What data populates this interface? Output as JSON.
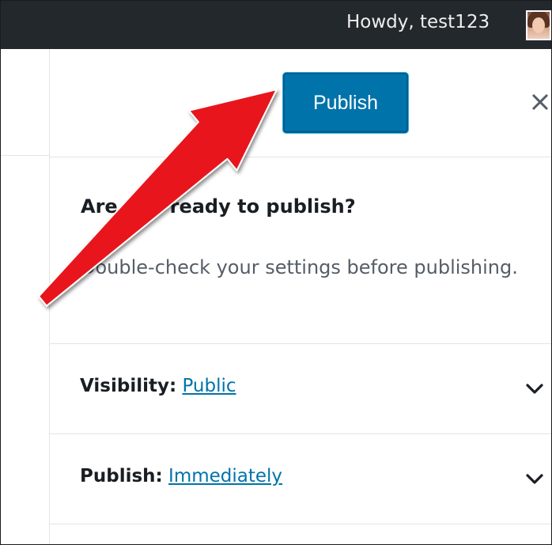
{
  "admin_bar": {
    "greeting": "Howdy, test123",
    "avatar_icon": "user-avatar"
  },
  "panel": {
    "publish_button_label": "Publish",
    "close_icon": "close-icon",
    "title": "Are you ready to publish?",
    "description": "Double-check your settings before publishing."
  },
  "settings": {
    "visibility": {
      "label": "Visibility:",
      "value": "Public",
      "icon": "chevron-down-icon"
    },
    "publish": {
      "label": "Publish:",
      "value": "Immediately",
      "icon": "chevron-down-icon"
    }
  },
  "colors": {
    "admin_bar": "#23282d",
    "primary_button": "#0073aa",
    "link": "#0073aa",
    "annotation_arrow": "#e8141c"
  }
}
